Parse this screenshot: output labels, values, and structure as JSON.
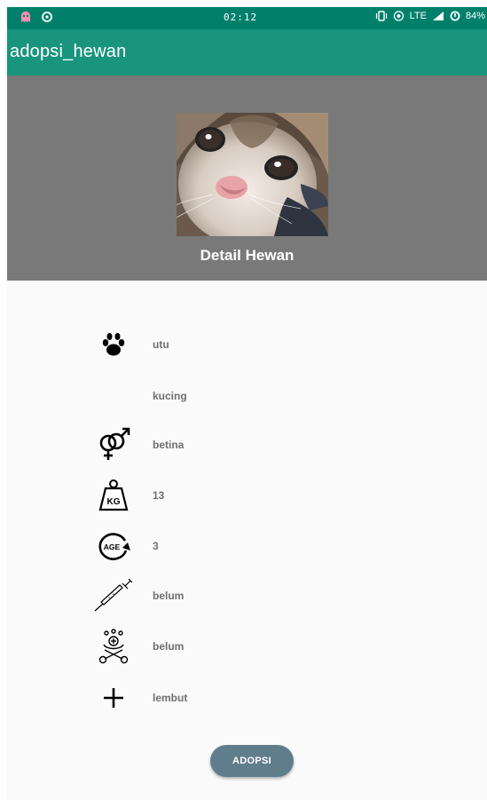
{
  "status_bar": {
    "time": "02:12",
    "network": "LTE",
    "battery": "84%",
    "icons": [
      "ghost-icon",
      "refresh-icon",
      "vibrate-icon",
      "hotspot-icon",
      "signal-icon",
      "battery-icon"
    ]
  },
  "app_bar": {
    "title": "adopsi_hewan",
    "color": "#19947d"
  },
  "header": {
    "title": "Detail Hewan",
    "background": "#797979",
    "photo": "cat-photo"
  },
  "details": [
    {
      "icon": "paw-icon",
      "value": "utu"
    },
    {
      "icon": "",
      "value": "kucing"
    },
    {
      "icon": "gender-icon",
      "value": "betina"
    },
    {
      "icon": "weight-icon",
      "value": "13"
    },
    {
      "icon": "age-icon",
      "value": "3"
    },
    {
      "icon": "syringe-icon",
      "value": "belum"
    },
    {
      "icon": "medical-icon",
      "value": "belum"
    },
    {
      "icon": "plus-icon",
      "value": "lembut"
    }
  ],
  "adopt_button": {
    "label": "ADOPSI",
    "color": "#607d8b"
  }
}
